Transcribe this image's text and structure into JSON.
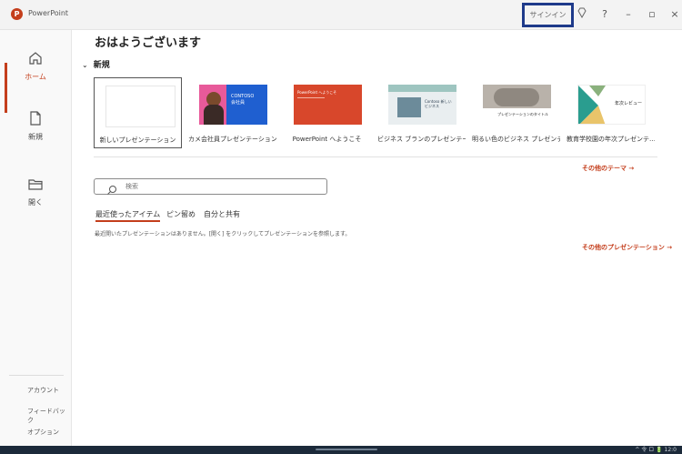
{
  "titlebar": {
    "app_name": "PowerPoint",
    "logo_letter": "P",
    "signin_label": "サインイン",
    "help_label": "?",
    "minimize_label": "–",
    "restore_label": "▫",
    "close_label": "×",
    "brand_color": "#c43e1c",
    "highlight_border_color": "#1e3a8a"
  },
  "sidebar": {
    "items": [
      {
        "label": "ホーム",
        "icon": "home-icon",
        "active": true
      },
      {
        "label": "新規",
        "icon": "new-file-icon"
      },
      {
        "label": "開く",
        "icon": "folder-open-icon"
      }
    ],
    "bottom_items": [
      "アカウント",
      "フィードバック",
      "オプション"
    ]
  },
  "main": {
    "greeting": "おはようございます",
    "new_section": {
      "chevron": "⌄",
      "title": "新規"
    },
    "templates": [
      {
        "name": "新しいプレゼンテーション"
      },
      {
        "name": "カメ会社員プレゼンテーション",
        "thumb_text_1": "CONTOSO",
        "thumb_text_2": "会社員"
      },
      {
        "name": "PowerPoint へようこそ",
        "thumb_text_1": "PowerPoint へようこそ"
      },
      {
        "name": "ビジネス ブランのプレゼンテー…",
        "thumb_text_1": "Contoso 新しいビジネス"
      },
      {
        "name": "明るい色のビジネス プレゼンテ…",
        "thumb_text_1": "プレゼンテーションのタイトル"
      },
      {
        "name": "教育学校園の年次プレゼンテ…",
        "thumb_text_1": "年次レビュー"
      }
    ],
    "more_themes_link": "その他のテーマ →",
    "search": {
      "placeholder": "検索"
    },
    "tabs": [
      "最近使ったアイテム",
      "ピン留め",
      "自分と共有"
    ],
    "empty_message": "最近開いたプレゼンテーションはありません。[開く] をクリックしてプレゼンテーションを参照します。",
    "more_presentations_link": "その他のプレゼンテーション →"
  },
  "taskbar": {
    "tray_text": "^  令  ロ  🔋  12:0"
  }
}
